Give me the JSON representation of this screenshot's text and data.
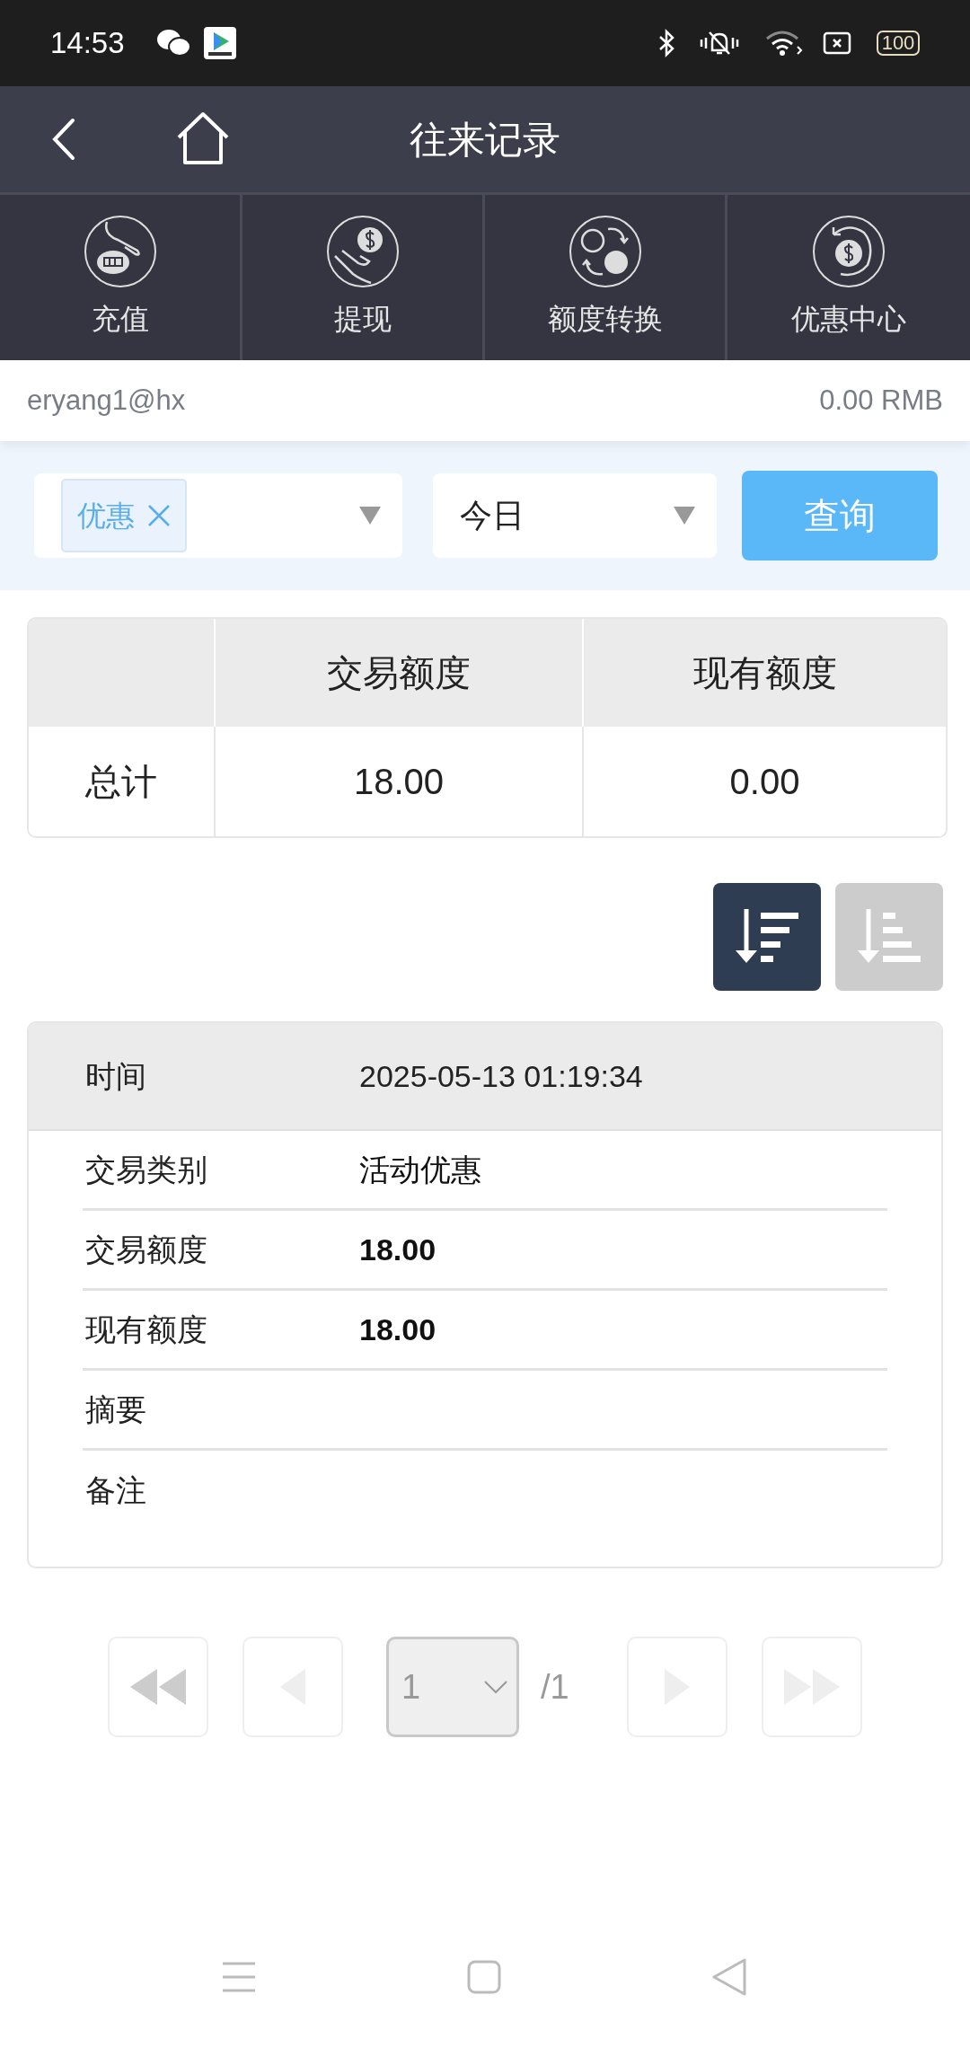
{
  "status_bar": {
    "time": "14:53",
    "battery": "100"
  },
  "header": {
    "title": "往来记录"
  },
  "shortcuts": [
    {
      "kind": "deposit",
      "label": "充值"
    },
    {
      "kind": "withdraw",
      "label": "提现"
    },
    {
      "kind": "transfer",
      "label": "额度转换"
    },
    {
      "kind": "promo",
      "label": "优惠中心"
    }
  ],
  "account": {
    "username": "eryang1@hx",
    "balance": "0.00 RMB"
  },
  "filters": {
    "type_tag": "优惠",
    "period": "今日",
    "query_button": "查询"
  },
  "summary_table": {
    "columns": [
      "交易额度",
      "现有额度"
    ],
    "rows": [
      {
        "label": "总计",
        "cells": [
          "18.00",
          "0.00"
        ]
      }
    ]
  },
  "sort_buttons": [
    {
      "kind": "desc",
      "selected": true
    },
    {
      "kind": "asc",
      "selected": false
    }
  ],
  "record": {
    "header": {
      "label": "时间",
      "value": "2025-05-13 01:19:34"
    },
    "fields": [
      {
        "label": "交易类别",
        "value": "活动优惠",
        "bold": false
      },
      {
        "label": "交易额度",
        "value": "18.00",
        "bold": true
      },
      {
        "label": "现有额度",
        "value": "18.00",
        "bold": true
      },
      {
        "label": "摘要"
      },
      {
        "label": "备注"
      }
    ]
  },
  "pagination": {
    "page": "1",
    "total": "/1"
  }
}
